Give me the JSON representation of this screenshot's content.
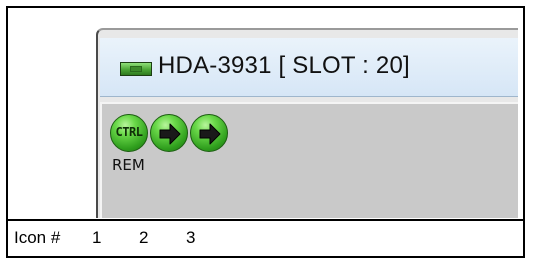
{
  "panel": {
    "title": "HDA-3931 [ SLOT : 20]",
    "status_icons": [
      {
        "kind": "ctrl-status-icon",
        "text": "CTRL",
        "label": "REM"
      },
      {
        "kind": "arrow-right-icon"
      },
      {
        "kind": "arrow-right-icon"
      }
    ],
    "colors": {
      "title_bar": "#dbe8f5",
      "icon_green": "#3cb224",
      "panel_body": "#c9c9c9"
    }
  },
  "caption": {
    "prefix": "Icon #",
    "numbers": [
      "1",
      "2",
      "3"
    ]
  }
}
